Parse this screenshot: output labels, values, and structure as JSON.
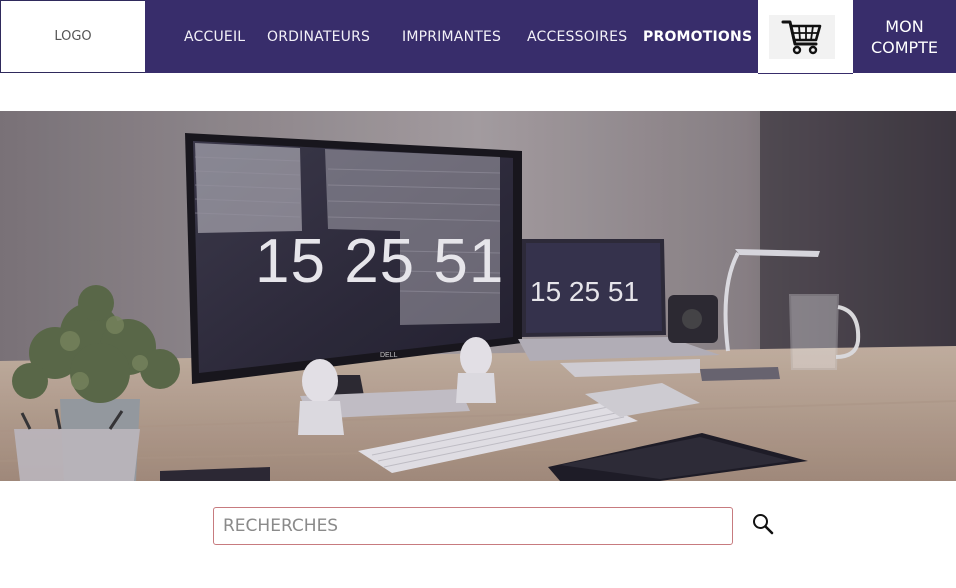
{
  "header": {
    "logo_text": "LOGO",
    "nav": [
      {
        "label": "ACCUEIL"
      },
      {
        "label": "ORDINATEURS"
      },
      {
        "label": "IMPRIMANTES"
      },
      {
        "label": "ACCESSOIRES"
      },
      {
        "label": "PROMOTIONS"
      }
    ],
    "cart_icon": "shopping-cart-icon",
    "account": {
      "line1": "MON",
      "line2": "COMPTE"
    }
  },
  "hero": {
    "monitor_clock": "15 25 51",
    "laptop_clock": "15 25 51",
    "monitor_brand": "DELL"
  },
  "search": {
    "placeholder": "RECHERCHES",
    "value": "",
    "icon": "search-icon"
  },
  "colors": {
    "nav_background": "#382d6b",
    "search_border": "#c77b7f"
  }
}
